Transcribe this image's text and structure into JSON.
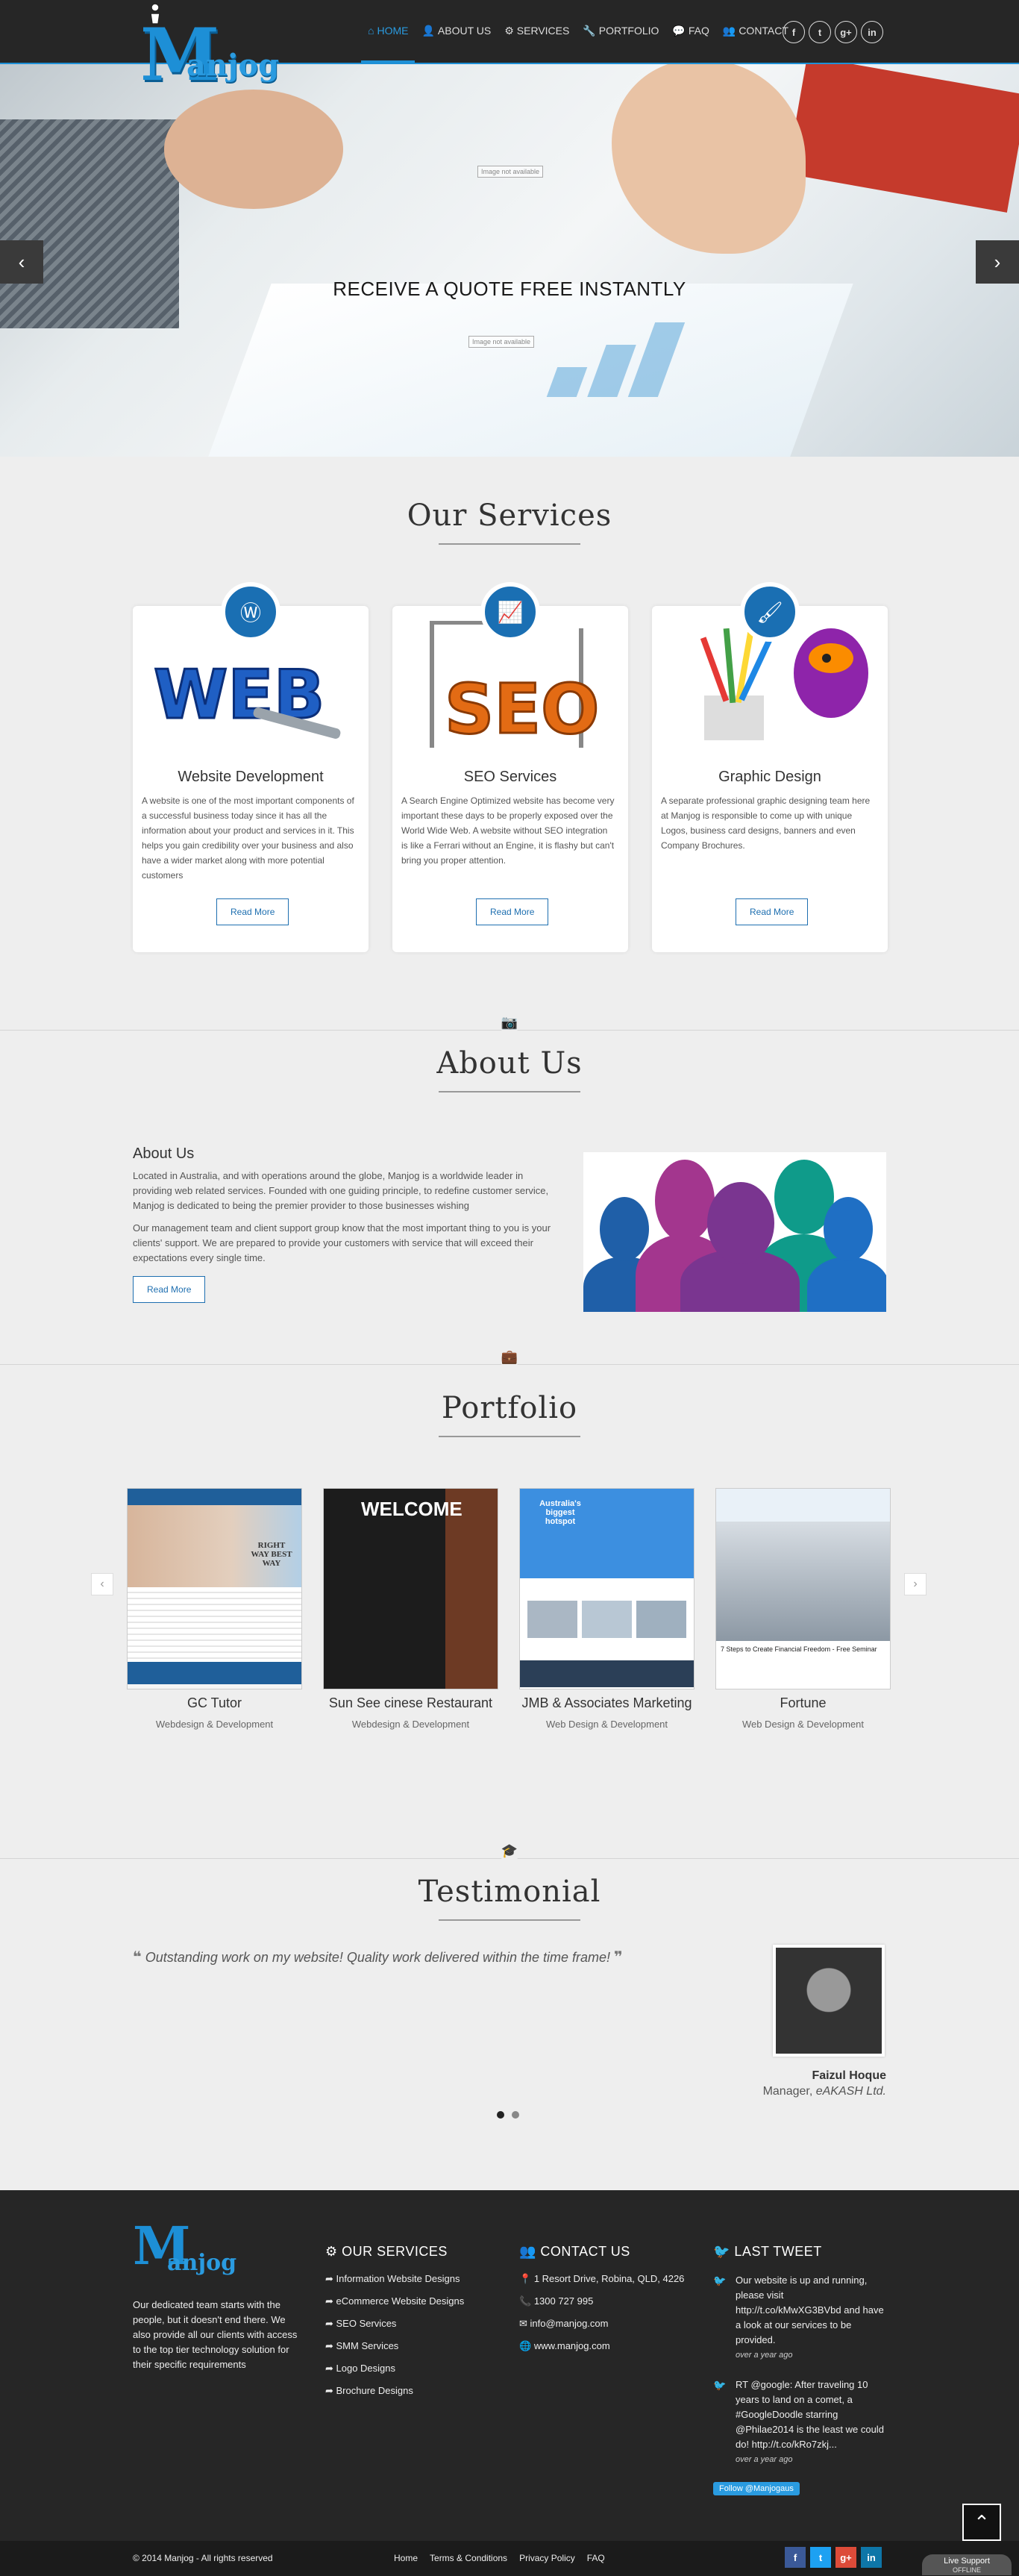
{
  "brand": {
    "logo_text": "Manjog",
    "logo_first": "M",
    "logo_rest": "anjog"
  },
  "nav": {
    "items": [
      {
        "label": "HOME",
        "icon": "home-icon"
      },
      {
        "label": "ABOUT US",
        "icon": "user-icon"
      },
      {
        "label": "SERVICES",
        "icon": "gears-icon"
      },
      {
        "label": "PORTFOLIO",
        "icon": "wrench-icon"
      },
      {
        "label": "FAQ",
        "icon": "comments-icon"
      },
      {
        "label": "CONTACT",
        "icon": "users-icon"
      }
    ],
    "social": [
      "f",
      "t",
      "g+",
      "in"
    ]
  },
  "hero": {
    "headline": "RECEIVE A QUOTE FREE INSTANTLY",
    "img_alt_1": "Image not available",
    "img_alt_2": "Image not available"
  },
  "services": {
    "title": "Our Services",
    "cards": [
      {
        "title": "Website Development",
        "text": "A website is one of the most important components of a successful business today since it has all the information about your product and services in it. This helps you gain credibility over your business and also have a wider market along with more potential customers",
        "button": "Read More",
        "badge_icon": "wordpress-icon",
        "img_text": "WEB"
      },
      {
        "title": "SEO Services",
        "text": "A Search Engine Optimized website has become very important these days to be properly exposed over the World Wide Web. A website without SEO integration is like a Ferrari without an Engine, it is flashy but can't bring you proper attention.",
        "button": "Read More",
        "badge_icon": "chart-icon",
        "img_text": "SEO"
      },
      {
        "title": "Graphic Design",
        "text": "A separate professional graphic designing team here at Manjog is responsible to come up with unique Logos, business card designs, banners and even Company Brochures.",
        "button": "Read More",
        "badge_icon": "brush-icon",
        "img_text": ""
      }
    ]
  },
  "about": {
    "title": "About Us",
    "subtitle": "About Us",
    "p1": "Located in Australia, and with operations around the globe, Manjog is a worldwide leader in providing web related services. Founded with one guiding principle, to redefine customer service, Manjog is dedicated to being the premier provider to those businesses wishing",
    "p2": "Our management team and client support group know that the most important thing to you is your clients' support. We are prepared to provide your customers with service that will exceed their expectations every single time.",
    "button": "Read More"
  },
  "portfolio": {
    "title": "Portfolio",
    "items": [
      {
        "name": "GC Tutor",
        "category": "Webdesign & Development",
        "shot_text": "RIGHT WAY BEST WAY"
      },
      {
        "name": "Sun See cinese Restaurant",
        "category": "Webdesign & Development",
        "shot_text": "WELCOME"
      },
      {
        "name": "JMB & Associates Marketing",
        "category": "Web Design & Development",
        "shot_text": "Australia's biggest hotspot"
      },
      {
        "name": "Fortune",
        "category": "Web Design & Development",
        "shot_text": "7 Steps to Create Financial Freedom - Free Seminar"
      }
    ]
  },
  "testimonial": {
    "title": "Testimonial",
    "quote": "Outstanding work on my website! Quality work delivered within the time frame!",
    "name": "Faizul Hoque",
    "role": "Manager, ",
    "company": "eAKASH Ltd."
  },
  "footer": {
    "about": "Our dedicated team starts with the people, but it doesn't end there. We also provide all our clients with access to the top tier technology solution for their specific requirements",
    "services_title": "OUR SERVICES",
    "services": [
      "Information Website Designs",
      "eCommerce Website Designs",
      "SEO Services",
      "SMM Services",
      "Logo Designs",
      "Brochure Designs"
    ],
    "contact_title": "CONTACT US",
    "contact": [
      "1 Resort Drive, Robina, QLD, 4226",
      "1300 727 995",
      "info@manjog.com",
      "www.manjog.com"
    ],
    "tweet_title": "LAST TWEET",
    "tweets": [
      {
        "text": "Our website is up and running, please visit http://t.co/kMwXG3BVbd and have a look at our services to be provided.",
        "time": "over a year ago"
      },
      {
        "text": "RT @google: After traveling 10 years to land on a comet, a #GoogleDoodle starring @Philae2014 is the least we could do! http://t.co/kRo7zkj...",
        "time": "over a year ago"
      }
    ],
    "follow": "Follow @Manjogaus"
  },
  "bottom": {
    "copyright": "© 2014 Manjog - All rights reserved",
    "links": [
      "Home",
      "Terms & Conditions",
      "Privacy Policy",
      "FAQ"
    ],
    "live_support": "Live Support",
    "offline": "OFFLINE"
  }
}
